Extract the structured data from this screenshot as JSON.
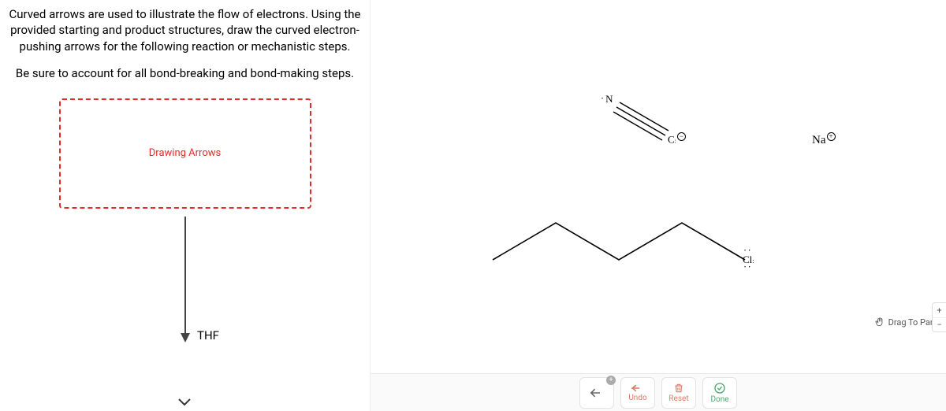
{
  "question": {
    "p1": "Curved arrows are used to illustrate the flow of electrons. Using the provided starting and product structures, draw the curved electron-pushing arrows for the following reaction or mechanistic steps.",
    "p2": "Be sure to account for all bond-breaking and bond-making steps.",
    "drawing_box_label": "Drawing Arrows",
    "reagent_label": "THF"
  },
  "atoms": {
    "nitrogen": "N",
    "carbon": "C",
    "sodium": "Na",
    "chlorine": "Cl",
    "minus": "−",
    "plus": "+"
  },
  "toolbar": {
    "undo": "Undo",
    "reset": "Reset",
    "done": "Done"
  },
  "hint": {
    "drag_to_pan": "Drag To Pan"
  },
  "zoom": {
    "in": "+",
    "out": "−"
  }
}
